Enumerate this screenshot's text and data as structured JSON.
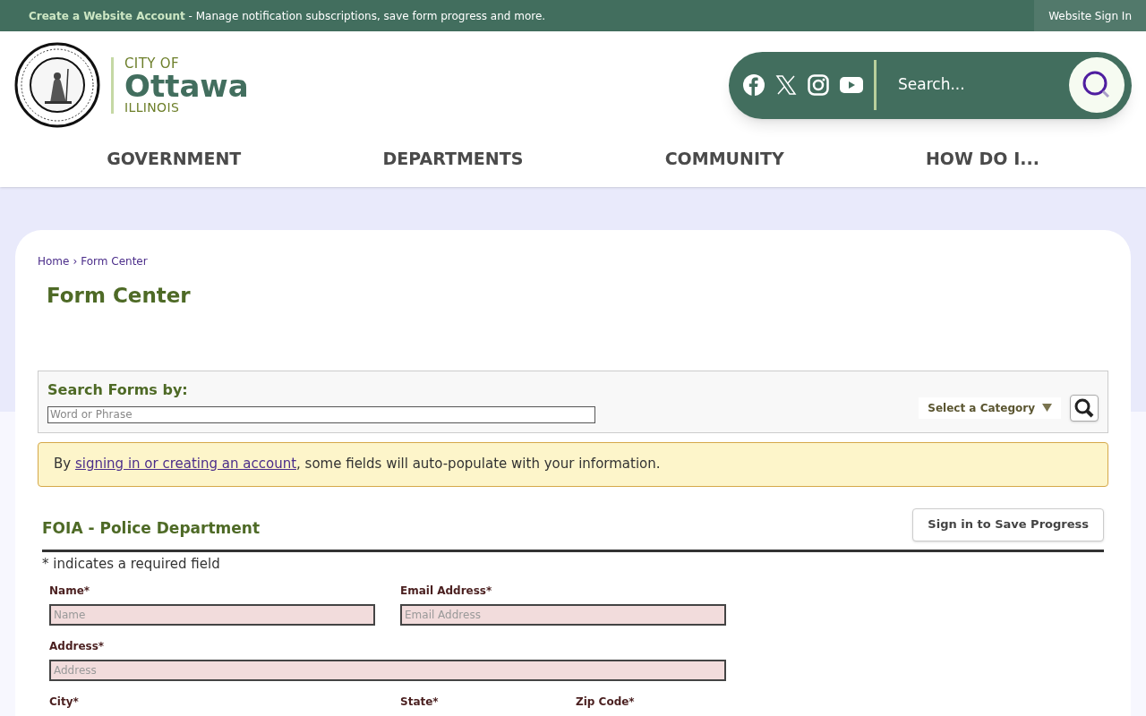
{
  "top_bar": {
    "link": "Create a Website Account",
    "text": " - Manage notification subscriptions, save form progress and more.",
    "sign_in": "Website Sign In"
  },
  "logo": {
    "line1": "CITY OF",
    "line2": "Ottawa",
    "line3": "ILLINOIS"
  },
  "search": {
    "placeholder": "Search..."
  },
  "nav": [
    "GOVERNMENT",
    "DEPARTMENTS",
    "COMMUNITY",
    "HOW DO I..."
  ],
  "breadcrumb": [
    "Home",
    "›",
    "Form Center"
  ],
  "page_title": "Form Center",
  "search_forms": {
    "label": "Search Forms by:",
    "placeholder": "Word or Phrase",
    "category": "Select a Category"
  },
  "notice": {
    "before": "By ",
    "link": "signing in or creating an account",
    "after": ", some fields will auto-populate with your information."
  },
  "form": {
    "title": "FOIA - Police Department",
    "save_button": "Sign in to Save Progress",
    "required_note": "* indicates a required field",
    "rows": [
      [
        {
          "label": "Name*",
          "placeholder": "Name"
        },
        {
          "label": "Email Address*",
          "placeholder": "Email Address"
        }
      ],
      [
        {
          "label": "Address*",
          "placeholder": "Address",
          "wide": true
        }
      ],
      [
        {
          "label": "City*"
        },
        {
          "label": "State*"
        },
        {
          "label": "Zip Code*"
        }
      ]
    ]
  }
}
